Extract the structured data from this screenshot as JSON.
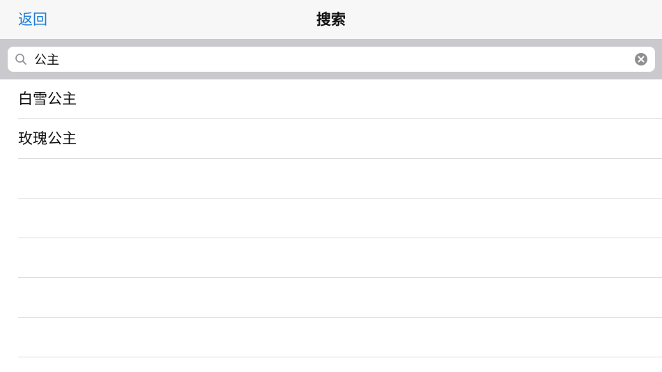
{
  "navbar": {
    "back_label": "返回",
    "title": "搜索"
  },
  "search": {
    "value": "公主",
    "search_icon": "search-icon",
    "clear_icon": "clear-icon"
  },
  "results": [
    {
      "label": "白雪公主"
    },
    {
      "label": "玫瑰公主"
    },
    {
      "label": ""
    },
    {
      "label": ""
    },
    {
      "label": ""
    },
    {
      "label": ""
    },
    {
      "label": ""
    }
  ],
  "colors": {
    "accent": "#1a7bd6",
    "search_bar_bg": "#c9c9ce",
    "navbar_bg": "#f7f7f7"
  }
}
